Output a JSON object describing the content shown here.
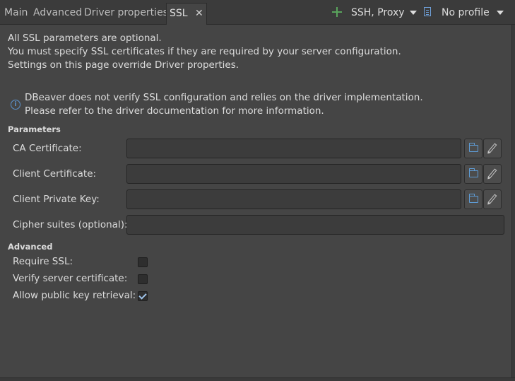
{
  "tabs": [
    {
      "label": "Main",
      "active": false
    },
    {
      "label": "Advanced",
      "active": false
    },
    {
      "label": "Driver properties",
      "active": false
    },
    {
      "label": "SSL",
      "active": true
    }
  ],
  "toolbar": {
    "ssh_proxy_label": "SSH, Proxy",
    "profile_label": "No profile"
  },
  "intro": {
    "line1": "All SSL parameters are optional.",
    "line2": "You must specify SSL certificates if they are required by your server configuration.",
    "line3": "Settings on this page override Driver properties."
  },
  "info": {
    "line1": "DBeaver does not verify SSL configuration and relies on the driver implementation.",
    "line2": "Please refer to the driver documentation for more information."
  },
  "parameters": {
    "title": "Parameters",
    "fields": [
      {
        "label": "CA Certificate:",
        "value": "",
        "has_buttons": true
      },
      {
        "label": "Client Certificate:",
        "value": "",
        "has_buttons": true
      },
      {
        "label": "Client Private Key:",
        "value": "",
        "has_buttons": true
      },
      {
        "label": "Cipher suites (optional):",
        "value": "",
        "has_buttons": false
      }
    ]
  },
  "advanced": {
    "title": "Advanced",
    "options": [
      {
        "label": "Require SSL:",
        "checked": false
      },
      {
        "label": "Verify server certificate:",
        "checked": false
      },
      {
        "label": "Allow public key retrieval:",
        "checked": true
      }
    ]
  },
  "colors": {
    "background": "#454545",
    "tabbar": "#3b3b3b",
    "accent_blue": "#5e9cd6",
    "plus_green": "#59a35c"
  }
}
